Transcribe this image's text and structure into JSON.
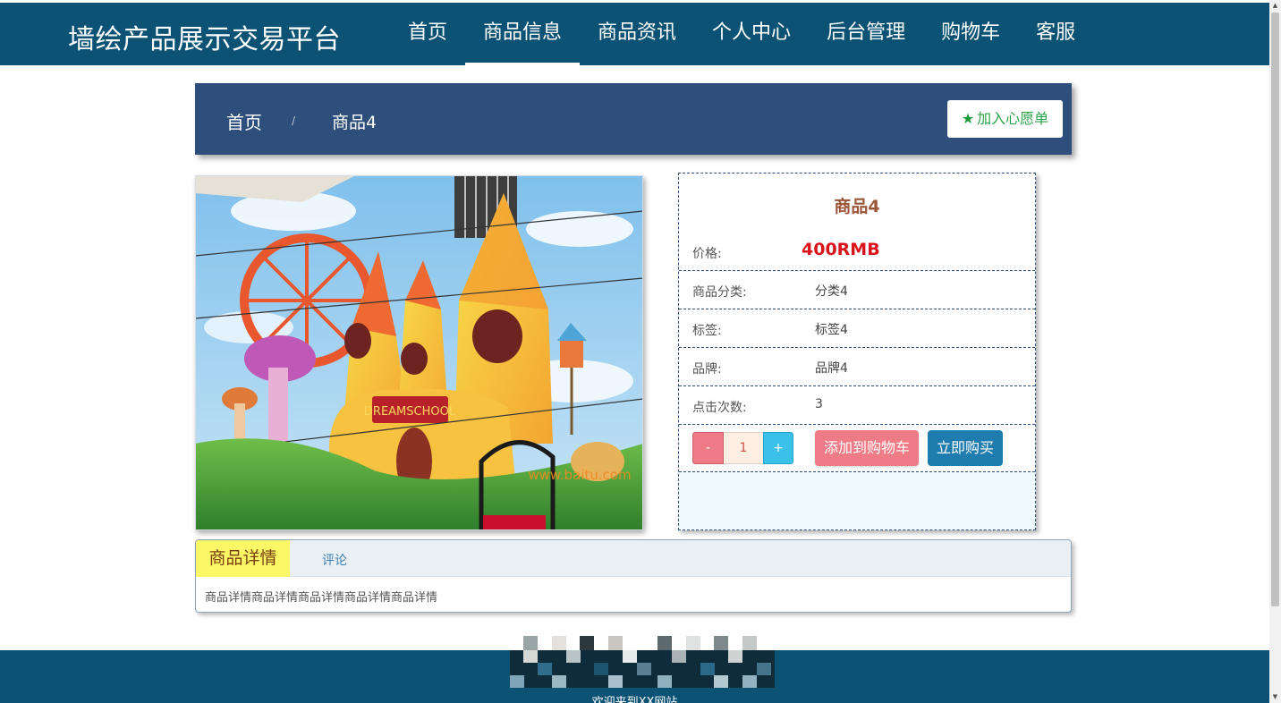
{
  "site": {
    "title": "墙绘产品展示交易平台"
  },
  "nav": {
    "items": [
      {
        "label": "首页"
      },
      {
        "label": "商品信息"
      },
      {
        "label": "商品资讯"
      },
      {
        "label": "个人中心"
      },
      {
        "label": "后台管理"
      },
      {
        "label": "购物车"
      },
      {
        "label": "客服"
      }
    ],
    "active": "商品信息"
  },
  "breadcrumb": {
    "home": "首页",
    "separator": "/",
    "current": "商品4"
  },
  "wishlist": {
    "icon": "star-icon",
    "label": "加入心愿单"
  },
  "product": {
    "name": "商品4",
    "price_label": "价格:",
    "price": "400RMB",
    "fields": [
      {
        "label": "商品分类:",
        "value": "分类4"
      },
      {
        "label": "标签:",
        "value": "标签4"
      },
      {
        "label": "品牌:",
        "value": "品牌4"
      },
      {
        "label": "点击次数:",
        "value": "3"
      }
    ],
    "image": {
      "caption": "DREAMSCHOOL",
      "watermark": "www.baitu.com"
    }
  },
  "quantity": {
    "minus": "-",
    "value": "1",
    "plus": "+"
  },
  "actions": {
    "add_to_cart": "添加到购物车",
    "buy_now": "立即购买"
  },
  "tabs": [
    {
      "label": "商品详情"
    },
    {
      "label": "评论"
    }
  ],
  "detail": {
    "text": "商品详情商品详情商品详情商品详情商品详情"
  },
  "footer": {
    "text": "欢迎来到XX网站"
  },
  "colors": {
    "nav_bg": "#0b5274",
    "breadcrumb_bg": "#2e4f7b",
    "price": "#d9151b",
    "cart_button": "#ef7b86",
    "buy_button": "#1f7cae",
    "active_tab": "#fbf766"
  }
}
